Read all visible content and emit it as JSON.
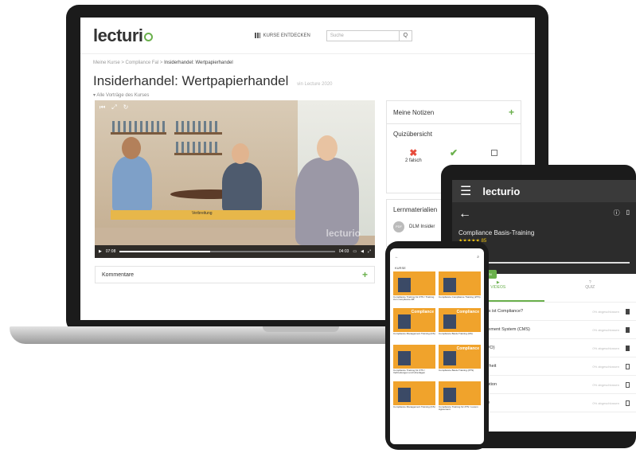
{
  "laptop": {
    "logo": "lecturi",
    "header": {
      "discover_label": "KURSE ENTDECKEN",
      "search_placeholder": "Suche",
      "search_button": "Q"
    },
    "breadcrumb": {
      "item1": "Meine Kurse",
      "sep1": ">",
      "item2": "Compliance Fal",
      "sep2": ">",
      "current": "Insiderhandel: Wertpapierhandel"
    },
    "title": "Insiderhandel: Wertpapierhandel",
    "title_suffix": "vin Lecture 2020",
    "back_link": "Alle Vorträge des Kurses",
    "video": {
      "bench_label": "Verbreitung",
      "watermark": "lecturio",
      "time_current": "07:08",
      "time_total": "04:03",
      "progress_fraction": 0.42
    },
    "notes": {
      "title": "Meine Notizen"
    },
    "quiz": {
      "title": "Quizübersicht",
      "wrong_label": "2 falsch"
    },
    "materials": {
      "title": "Lernmaterialien",
      "pdf_badge": "PDF",
      "item": "DLM Insider"
    },
    "comments": {
      "title": "Kommentare"
    }
  },
  "tablet": {
    "logo": "lecturio",
    "menu_icon": "☰",
    "back_icon": "←",
    "course_title": "Compliance Basis-Training",
    "stars": "★★★★★ 85",
    "progress_text": "PROGRESS 0%",
    "progress_label": "Lektüre/Ansehen",
    "progress_fraction": 1.0,
    "progress_value": "0%",
    "add_button": "NEU HINZUFÜGEN",
    "tabs": [
      {
        "label": "VIDEOS",
        "icon": "▶"
      },
      {
        "label": "QUIZ",
        "icon": "?"
      }
    ],
    "items": [
      {
        "title": "...überblick: Was ist Compliance?",
        "status": "0% abgeschlossen",
        "bookmarked": true
      },
      {
        "title": "...liance Management System (CMS)",
        "status": "0% abgeschlossen",
        "bookmarked": true
      },
      {
        "title": "...schutz (DSGVO)",
        "status": "0% abgeschlossen",
        "bookmarked": true
      },
      {
        "title": "...mationssicherheit",
        "status": "0% abgeschlossen",
        "bookmarked": false
      },
      {
        "title": "...uptionsprävention",
        "status": "0% abgeschlossen",
        "bookmarked": false
      },
      {
        "title": "...essenkonflikte",
        "status": "0% abgeschlossen",
        "bookmarked": false
      }
    ]
  },
  "phone": {
    "back_icon": "←",
    "search_icon": "⌕",
    "section_label": "KURSE",
    "cards": [
      {
        "title": "",
        "label": "Compliance Training für ZTS / Training zum compliance AB"
      },
      {
        "title": "",
        "label": "Compliance Compliance Training (ZTS)"
      },
      {
        "title": "Compliance",
        "label": "Compliance Management Training (DS)"
      },
      {
        "title": "Compliance",
        "label": "Compliance Basis-Training (DS)"
      },
      {
        "title": "",
        "label": "Compliance Training für ZTS / Verbreitungen und Unterlagen"
      },
      {
        "title": "Compliance",
        "label": "Compliance Basis-Training (ZTS)"
      },
      {
        "title": "",
        "label": "Compliance Management Training (DS)"
      },
      {
        "title": "",
        "label": "Compliance Training für ZTS / Lucem Agreement"
      }
    ]
  }
}
